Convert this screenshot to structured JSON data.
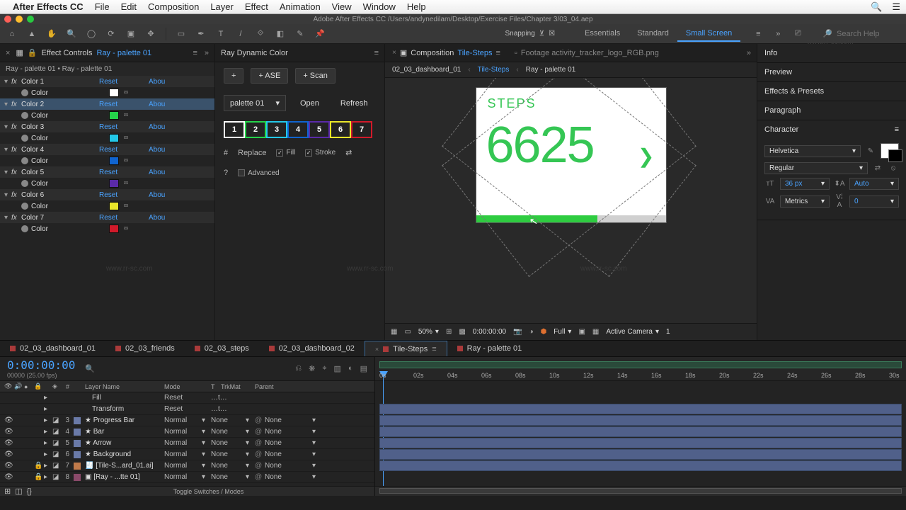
{
  "menubar": {
    "app": "After Effects CC",
    "items": [
      "File",
      "Edit",
      "Composition",
      "Layer",
      "Effect",
      "Animation",
      "View",
      "Window",
      "Help"
    ]
  },
  "titlebar": "Adobe After Effects CC   /Users/andynedilam/Desktop/Exercise Files/Chapter 3/03_04.aep",
  "toolbar": {
    "snapping": "Snapping",
    "workspaces": {
      "items": [
        "Essentials",
        "Standard",
        "Small Screen"
      ],
      "active": "Small Screen"
    },
    "search_ph": "Search Help"
  },
  "effectControls": {
    "tab": "Effect Controls",
    "sub": "Ray - palette 01",
    "path": "Ray - palette 01 • Ray - palette 01",
    "reset": "Reset",
    "about": "Abou",
    "colorLabel": "Color",
    "items": [
      {
        "name": "Color 1",
        "hex": "#ffffff"
      },
      {
        "name": "Color 2",
        "hex": "#25d34a"
      },
      {
        "name": "Color 3",
        "hex": "#23c8e8"
      },
      {
        "name": "Color 4",
        "hex": "#1064d0"
      },
      {
        "name": "Color 5",
        "hex": "#5a2aa8"
      },
      {
        "name": "Color 6",
        "hex": "#e9e62a"
      },
      {
        "name": "Color 7",
        "hex": "#d11a2a"
      }
    ],
    "selected": 1
  },
  "ray": {
    "title": "Ray Dynamic Color",
    "plus": "+",
    "ase": "+ ASE",
    "scan": "+ Scan",
    "palette": "palette 01",
    "open": "Open",
    "refresh": "Refresh",
    "swatches": [
      {
        "n": "1",
        "border": "#ffffff",
        "bg": "#222"
      },
      {
        "n": "2",
        "border": "#25d34a",
        "bg": "#222"
      },
      {
        "n": "3",
        "border": "#23c8e8",
        "bg": "#222"
      },
      {
        "n": "4",
        "border": "#1064d0",
        "bg": "#222"
      },
      {
        "n": "5",
        "border": "#5a2aa8",
        "bg": "#222"
      },
      {
        "n": "6",
        "border": "#e9e62a",
        "bg": "#222"
      },
      {
        "n": "7",
        "border": "#d11a2a",
        "bg": "#222"
      }
    ],
    "hash": "#",
    "replace": "Replace",
    "fill": "Fill",
    "stroke": "Stroke",
    "q": "?",
    "advanced": "Advanced"
  },
  "comp": {
    "tabs": [
      {
        "label": "Composition",
        "sub": "Tile-Steps",
        "active": true
      },
      {
        "label": "Footage activity_tracker_logo_RGB.png",
        "active": false
      }
    ],
    "crumbs": [
      "02_03_dashboard_01",
      "Tile-Steps",
      "Ray - palette 01"
    ],
    "crumbActive": 1,
    "tile": {
      "title": "STEPS",
      "value": "6625",
      "arrow": "❯",
      "progress": 0.64
    },
    "footer": {
      "zoom": "50%",
      "time": "0:00:00:00",
      "res": "Full",
      "camera": "Active Camera",
      "view": "1"
    }
  },
  "rightPanels": {
    "info": "Info",
    "preview": "Preview",
    "ep": "Effects & Presets",
    "paragraph": "Paragraph",
    "character": {
      "title": "Character",
      "font": "Helvetica",
      "style": "Regular",
      "size": "36 px",
      "leading": "Auto",
      "kerning": "Metrics",
      "tracking": "0"
    }
  },
  "timelineTabs": {
    "items": [
      "02_03_dashboard_01",
      "02_03_friends",
      "02_03_steps",
      "02_03_dashboard_02",
      "Tile-Steps",
      "Ray - palette 01"
    ],
    "active": 4
  },
  "timeline": {
    "tc": "0:00:00:00",
    "fps": "00000 (25.00 fps)",
    "cols": {
      "num": "#",
      "name": "Layer Name",
      "mode": "Mode",
      "t": "T",
      "trk": "TrkMat",
      "parent": "Parent"
    },
    "mode_reset": "Reset",
    "mode_normal": "Normal",
    "trk_none": "None",
    "par_none": "None",
    "trk_dots": "…t…",
    "rows": [
      {
        "type": "sub",
        "name": "Fill",
        "mode": "Reset"
      },
      {
        "type": "sub",
        "name": "Transform",
        "mode": "Reset"
      },
      {
        "idx": "3",
        "lab": "#6a7aa8",
        "name": "Progress Bar",
        "star": true
      },
      {
        "idx": "4",
        "lab": "#6a7aa8",
        "name": "Bar",
        "star": true
      },
      {
        "idx": "5",
        "lab": "#6a7aa8",
        "name": "Arrow",
        "star": true
      },
      {
        "idx": "6",
        "lab": "#6a7aa8",
        "name": "Background",
        "star": true
      },
      {
        "idx": "7",
        "lab": "#c07a4a",
        "name": "[Tile-S...ard_01.ai]",
        "ai": true,
        "locked": true
      },
      {
        "idx": "8",
        "lab": "#8a4a6a",
        "name": "[Ray - ...tte 01]",
        "comp": true,
        "locked": true
      }
    ],
    "ticks": [
      "0s",
      "02s",
      "04s",
      "06s",
      "08s",
      "10s",
      "12s",
      "14s",
      "16s",
      "18s",
      "20s",
      "22s",
      "24s",
      "26s",
      "28s",
      "30s"
    ],
    "toggle": "Toggle Switches / Modes"
  }
}
